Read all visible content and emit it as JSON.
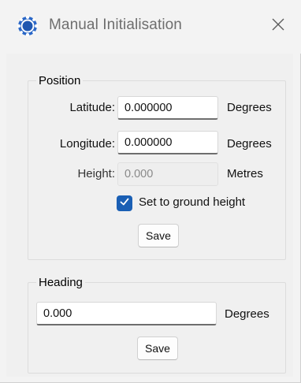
{
  "window": {
    "title": "Manual Initialisation",
    "icon": "app-globe-icon",
    "close_icon": "close-icon"
  },
  "position": {
    "legend": "Position",
    "latitude_label": "Latitude:",
    "latitude_value": "0.000000",
    "latitude_unit": "Degrees",
    "longitude_label": "Longitude:",
    "longitude_value": "0.000000",
    "longitude_unit": "Degrees",
    "height_label": "Height:",
    "height_value": "0.000",
    "height_unit": "Metres",
    "ground_checkbox_label": "Set to ground height",
    "ground_checkbox_checked": true,
    "save_label": "Save"
  },
  "heading": {
    "legend": "Heading",
    "value": "0.000",
    "unit": "Degrees",
    "save_label": "Save"
  },
  "colors": {
    "accent": "#1a5fb4",
    "window_bg": "#f3f3f3"
  }
}
